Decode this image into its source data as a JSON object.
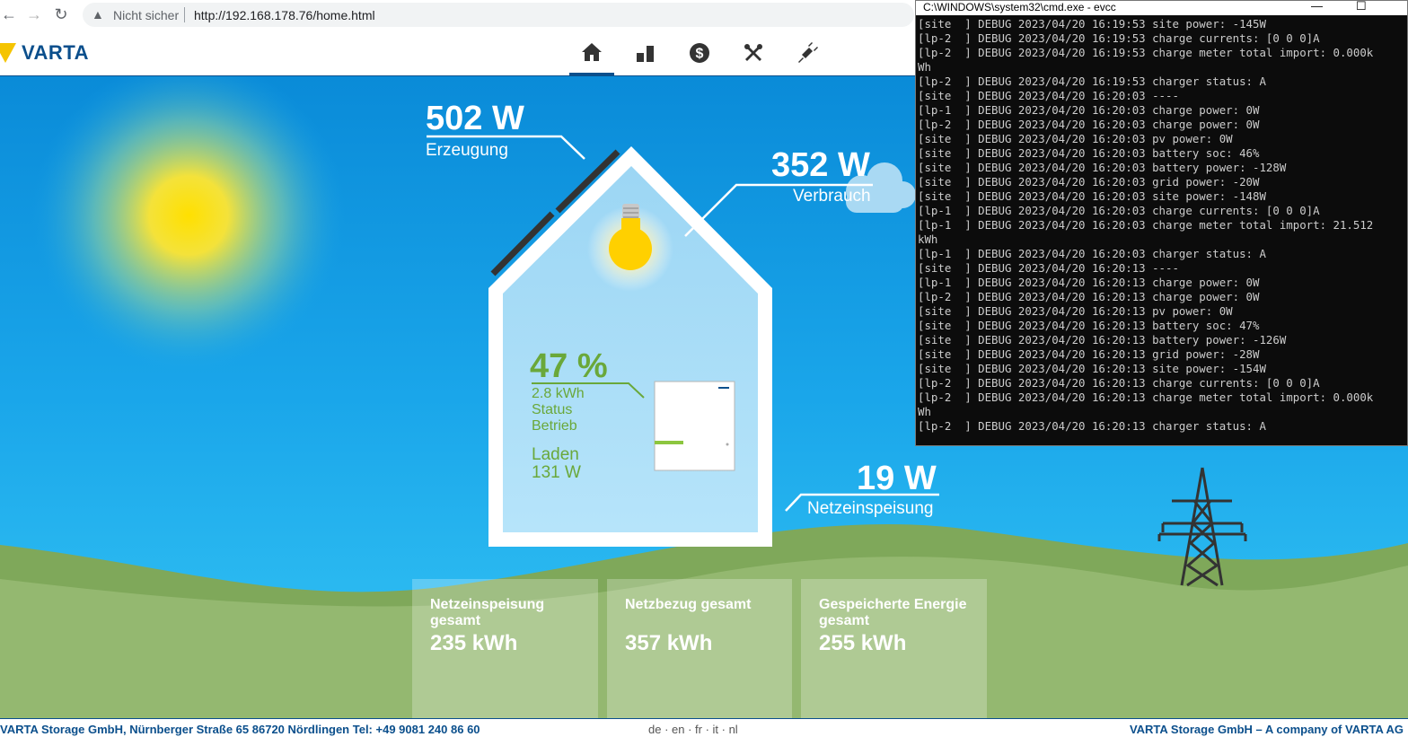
{
  "browser": {
    "warning_text": "Nicht sicher",
    "url": "http://192.168.178.76/home.html"
  },
  "header": {
    "brand": "VARTA",
    "nav": [
      "home-icon",
      "chart-icon",
      "dollar-icon",
      "tools-icon",
      "plug-icon"
    ]
  },
  "energy": {
    "generation_value": "502 W",
    "generation_label": "Erzeugung",
    "consumption_value": "352 W",
    "consumption_label": "Verbrauch",
    "grid_value": "19 W",
    "grid_label": "Netzeinspeisung"
  },
  "battery": {
    "soc": "47 %",
    "energy": "2.8 kWh",
    "status_label": "Status",
    "status_value": "Betrieb",
    "mode": "Laden",
    "power": "131 W"
  },
  "tiles": [
    {
      "title": "Netzeinspeisung gesamt",
      "value": "235 kWh"
    },
    {
      "title": "Netzbezug gesamt",
      "value": "357 kWh"
    },
    {
      "title": "Gespeicherte Energie gesamt",
      "value": "255 kWh"
    }
  ],
  "footer": {
    "left": "VARTA Storage GmbH, Nürnberger Straße 65 86720 Nördlingen Tel: +49 9081 240 86 60",
    "languages": "de · en · fr · it · nl",
    "right": "VARTA Storage GmbH – A company of VARTA AG"
  },
  "console": {
    "title": "C:\\WINDOWS\\system32\\cmd.exe - evcc",
    "log": "[site  ] DEBUG 2023/04/20 16:19:53 site power: -145W\n[lp-2  ] DEBUG 2023/04/20 16:19:53 charge currents: [0 0 0]A\n[lp-2  ] DEBUG 2023/04/20 16:19:53 charge meter total import: 0.000k\nWh\n[lp-2  ] DEBUG 2023/04/20 16:19:53 charger status: A\n[site  ] DEBUG 2023/04/20 16:20:03 ----\n[lp-1  ] DEBUG 2023/04/20 16:20:03 charge power: 0W\n[lp-2  ] DEBUG 2023/04/20 16:20:03 charge power: 0W\n[site  ] DEBUG 2023/04/20 16:20:03 pv power: 0W\n[site  ] DEBUG 2023/04/20 16:20:03 battery soc: 46%\n[site  ] DEBUG 2023/04/20 16:20:03 battery power: -128W\n[site  ] DEBUG 2023/04/20 16:20:03 grid power: -20W\n[site  ] DEBUG 2023/04/20 16:20:03 site power: -148W\n[lp-1  ] DEBUG 2023/04/20 16:20:03 charge currents: [0 0 0]A\n[lp-1  ] DEBUG 2023/04/20 16:20:03 charge meter total import: 21.512\nkWh\n[lp-1  ] DEBUG 2023/04/20 16:20:03 charger status: A\n[site  ] DEBUG 2023/04/20 16:20:13 ----\n[lp-1  ] DEBUG 2023/04/20 16:20:13 charge power: 0W\n[lp-2  ] DEBUG 2023/04/20 16:20:13 charge power: 0W\n[site  ] DEBUG 2023/04/20 16:20:13 pv power: 0W\n[site  ] DEBUG 2023/04/20 16:20:13 battery soc: 47%\n[site  ] DEBUG 2023/04/20 16:20:13 battery power: -126W\n[site  ] DEBUG 2023/04/20 16:20:13 grid power: -28W\n[site  ] DEBUG 2023/04/20 16:20:13 site power: -154W\n[lp-2  ] DEBUG 2023/04/20 16:20:13 charge currents: [0 0 0]A\n[lp-2  ] DEBUG 2023/04/20 16:20:13 charge meter total import: 0.000k\nWh\n[lp-2  ] DEBUG 2023/04/20 16:20:13 charger status: A"
  }
}
